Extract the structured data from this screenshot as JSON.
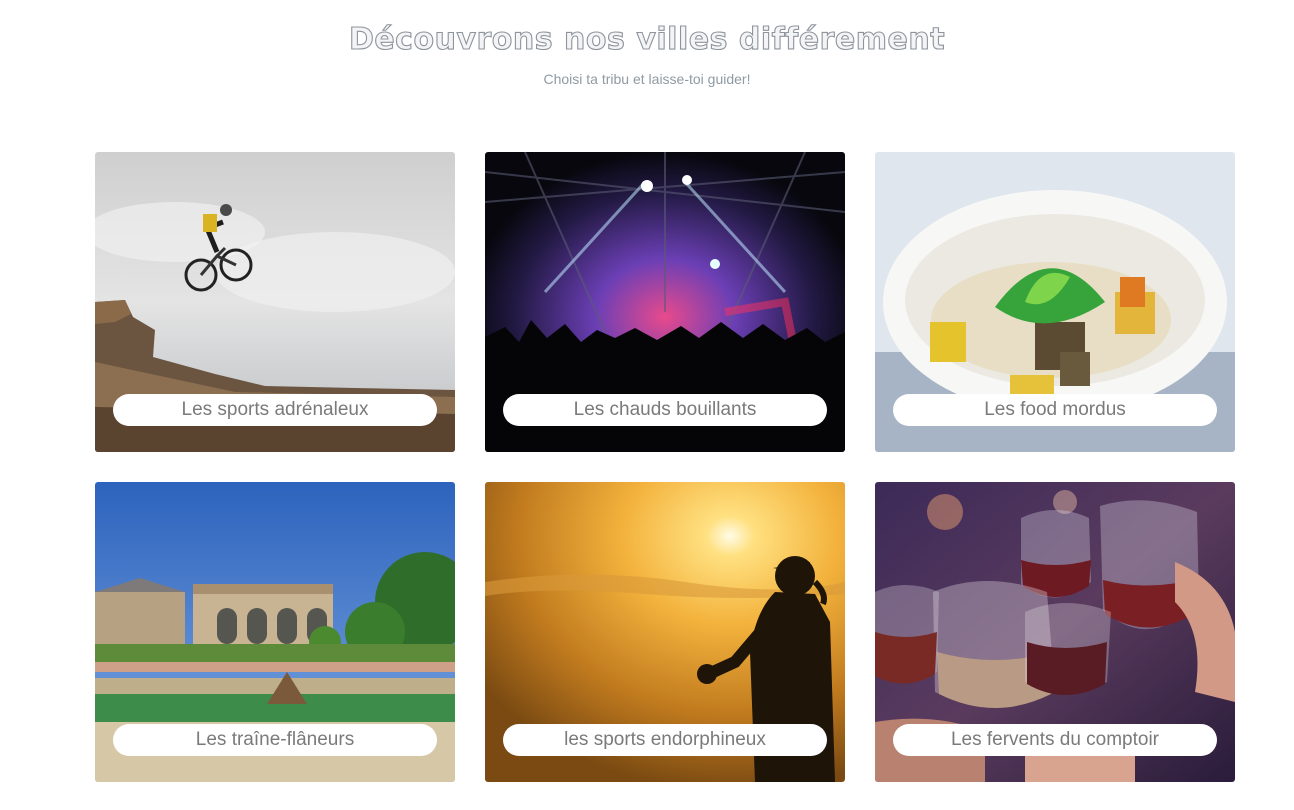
{
  "header": {
    "title": "Découvrons nos villes différement",
    "subtitle": "Choisi ta tribu et laisse-toi guider!"
  },
  "tribes": [
    {
      "label": "Les sports adrénaleux",
      "image": "mountain-bike-jump-photo"
    },
    {
      "label": "Les chauds bouillants",
      "image": "concert-crowd-photo"
    },
    {
      "label": "Les food mordus",
      "image": "noodle-bowl-photo"
    },
    {
      "label": "Les traîne-flâneurs",
      "image": "palace-garden-photo"
    },
    {
      "label": "les sports endorphineux",
      "image": "sunset-runner-photo"
    },
    {
      "label": "Les fervents du comptoir",
      "image": "beer-glasses-toast-photo"
    }
  ]
}
